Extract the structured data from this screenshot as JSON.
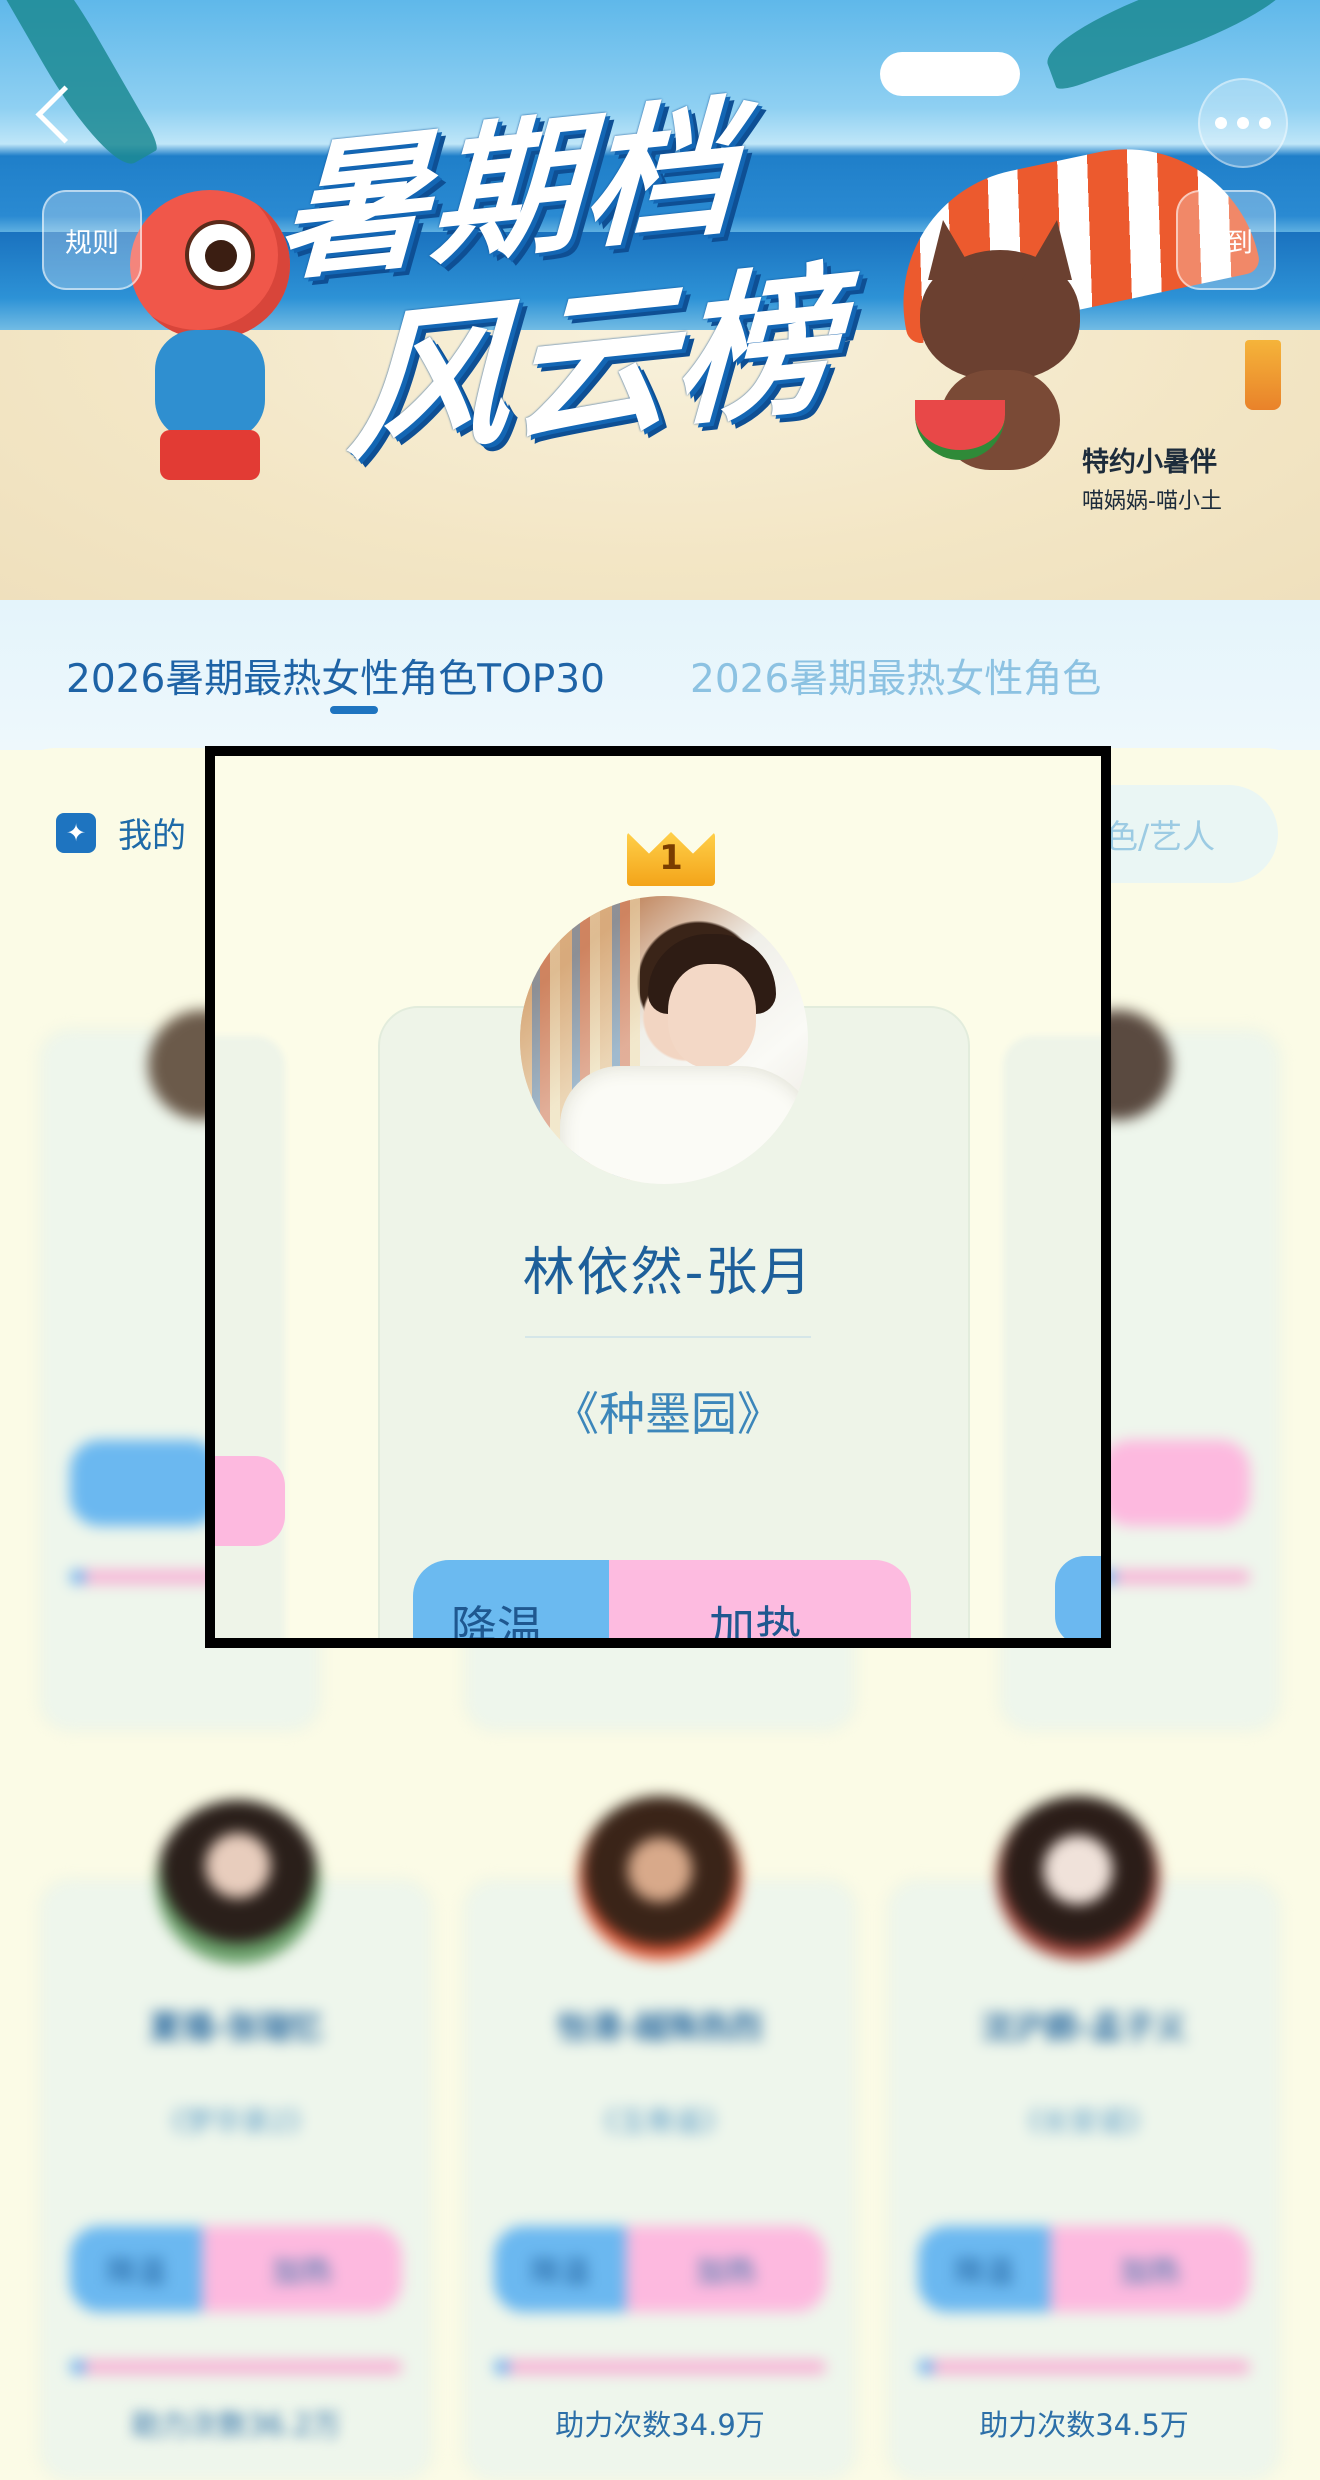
{
  "banner": {
    "title_line1": "暑期档",
    "title_line2": "风云榜",
    "sponsor_line1": "特约小暑伴",
    "sponsor_line2": "喵娲娲-喵小土",
    "rule_label": "规则",
    "checkin_label": "签到"
  },
  "tabs": [
    {
      "label": "2026暑期最热女性角色TOP30",
      "active": true
    },
    {
      "label": "2026暑期最热女性角色",
      "active": false
    }
  ],
  "panel": {
    "my_label": "我的",
    "search_placeholder": "角色/艺人"
  },
  "focus_card": {
    "rank": "1",
    "name": "林依然-张月",
    "work": "《种墨园》",
    "cool_label": "降温",
    "heat_label": "加热"
  },
  "background_cards": {
    "cool_label": "降温",
    "heat_label": "加热",
    "row2": [
      {
        "name": "夏禧-张瑞忆",
        "work": "《梦华录2》",
        "count": "助力次数36.2万"
      },
      {
        "name": "怡清-越殊热烈",
        "work": "《玉骨遥》",
        "count": "助力次数34.9万"
      },
      {
        "name": "沈沪颜-孟子义",
        "work": "《长安诺》",
        "count": "助力次数34.5万"
      }
    ]
  },
  "colors": {
    "accent": "#1e74c0",
    "cool": "#6bb8f0",
    "heat": "#fdb9df",
    "background": "#fbfbe6"
  }
}
